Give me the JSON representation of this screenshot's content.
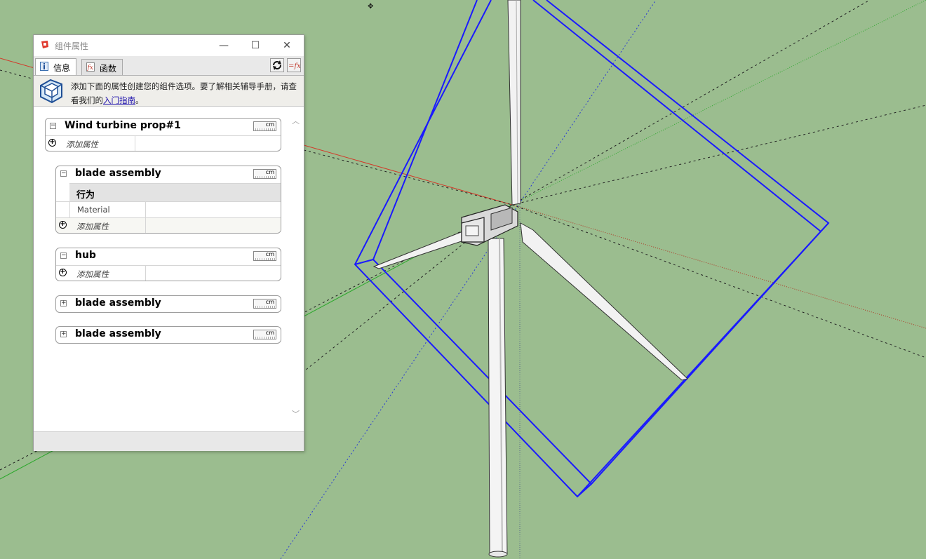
{
  "colors": {
    "viewport_bg": "#9bbd8f",
    "selection_blue": "#1a1aff",
    "axis_red": "#d23a2a",
    "axis_green": "#2da82d",
    "axis_blue": "#2a3cd2"
  },
  "dialog": {
    "title": "组件属性",
    "window_buttons": {
      "minimize": "—",
      "maximize": "☐",
      "close": "✕"
    },
    "tabs": [
      {
        "label": "信息",
        "icon": "info-icon",
        "active": true
      },
      {
        "label": "函数",
        "icon": "function-icon",
        "active": false
      }
    ],
    "toolbar": {
      "refresh_icon": "refresh-icon",
      "formula_icon": "toggle-formula-icon"
    },
    "info": {
      "text": "添加下面的属性创建您的组件选项。要了解相关辅导手册，请查看我们的",
      "link": "入门指南",
      "suffix": "。"
    },
    "groups": [
      {
        "title": "Wind turbine prop#1",
        "expanded": true,
        "unit": "cm",
        "add_label": "添加属性"
      },
      {
        "title": "blade assembly",
        "expanded": true,
        "unit": "cm",
        "section": "行为",
        "property": "Material",
        "add_label": "添加属性"
      },
      {
        "title": "hub",
        "expanded": true,
        "unit": "cm",
        "add_label": "添加属性"
      },
      {
        "title": "blade assembly",
        "expanded": false,
        "unit": "cm"
      },
      {
        "title": "blade assembly",
        "expanded": false,
        "unit": "cm"
      }
    ],
    "expand_symbol": "+",
    "collapse_symbol": "−",
    "add_symbol": "+"
  }
}
